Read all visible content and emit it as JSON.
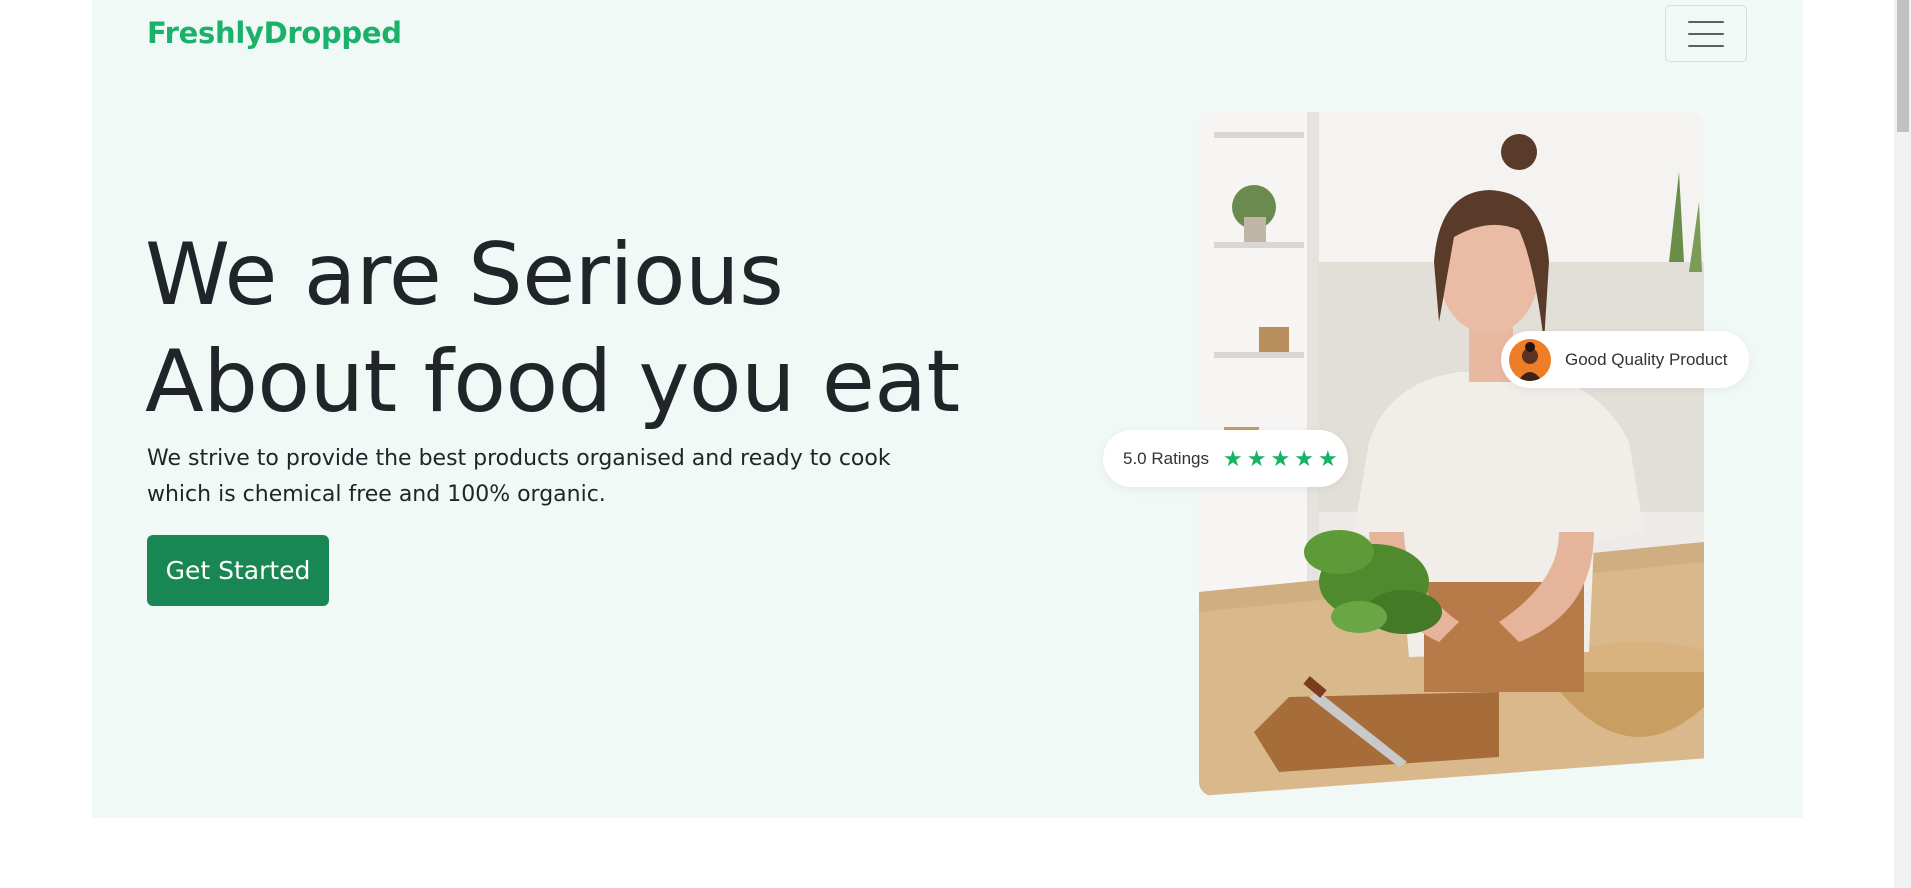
{
  "navbar": {
    "brand": "FreshlyDropped",
    "menu_icon": "hamburger-menu-icon"
  },
  "hero": {
    "headline_line1": "We are Serious",
    "headline_line2": "About food you eat",
    "subtext": "We strive to provide the best products organised and ready to cook which is chemical free and 100% organic.",
    "cta_label": "Get Started",
    "image_alt": "Woman preparing leafy greens in a kitchen"
  },
  "badges": {
    "quality_label": "Good Quality Product",
    "rating_label": "5.0 Ratings",
    "rating_value": 5,
    "rating_max": 5,
    "star_icon": "star-icon"
  },
  "colors": {
    "brand": "#1ab26b",
    "hero_bg": "#f0f9f5",
    "cta_bg": "#198754",
    "star": "#16b364",
    "headline": "#212529"
  }
}
